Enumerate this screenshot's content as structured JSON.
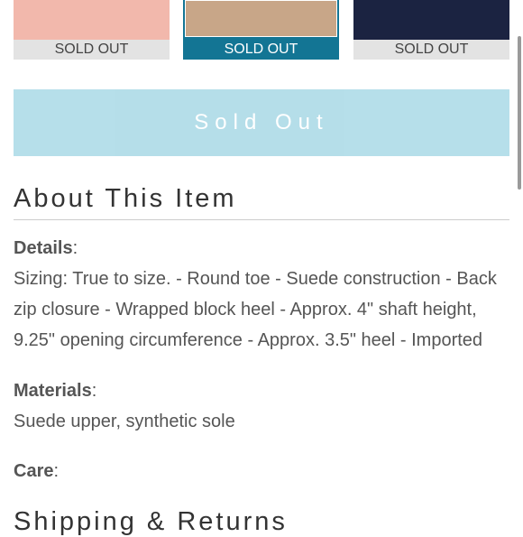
{
  "swatches": [
    {
      "label": "SOLD OUT",
      "color": "#f2b8ac",
      "label_bg": "#e3e3e3"
    },
    {
      "label": "SOLD OUT",
      "color": "#c8a688",
      "label_bg": "#137594",
      "selected": true
    },
    {
      "label": "SOLD OUT",
      "color": "#1b2341",
      "label_bg": "#e3e3e3"
    }
  ],
  "sold_out_button": {
    "label": "Sold Out",
    "color": "#a9d9e6"
  },
  "about": {
    "heading": "About This Item",
    "details_label": "Details",
    "details_text": "Sizing: True to size. - Round toe - Suede construction - Back zip closure - Wrapped block heel - Approx. 4\" shaft height, 9.25\" opening circumference - Approx. 3.5\" heel - Imported",
    "materials_label": "Materials",
    "materials_text": "Suede upper, synthetic sole",
    "care_label": "Care",
    "colon": ":"
  },
  "shipping": {
    "heading": "Shipping & Returns"
  }
}
